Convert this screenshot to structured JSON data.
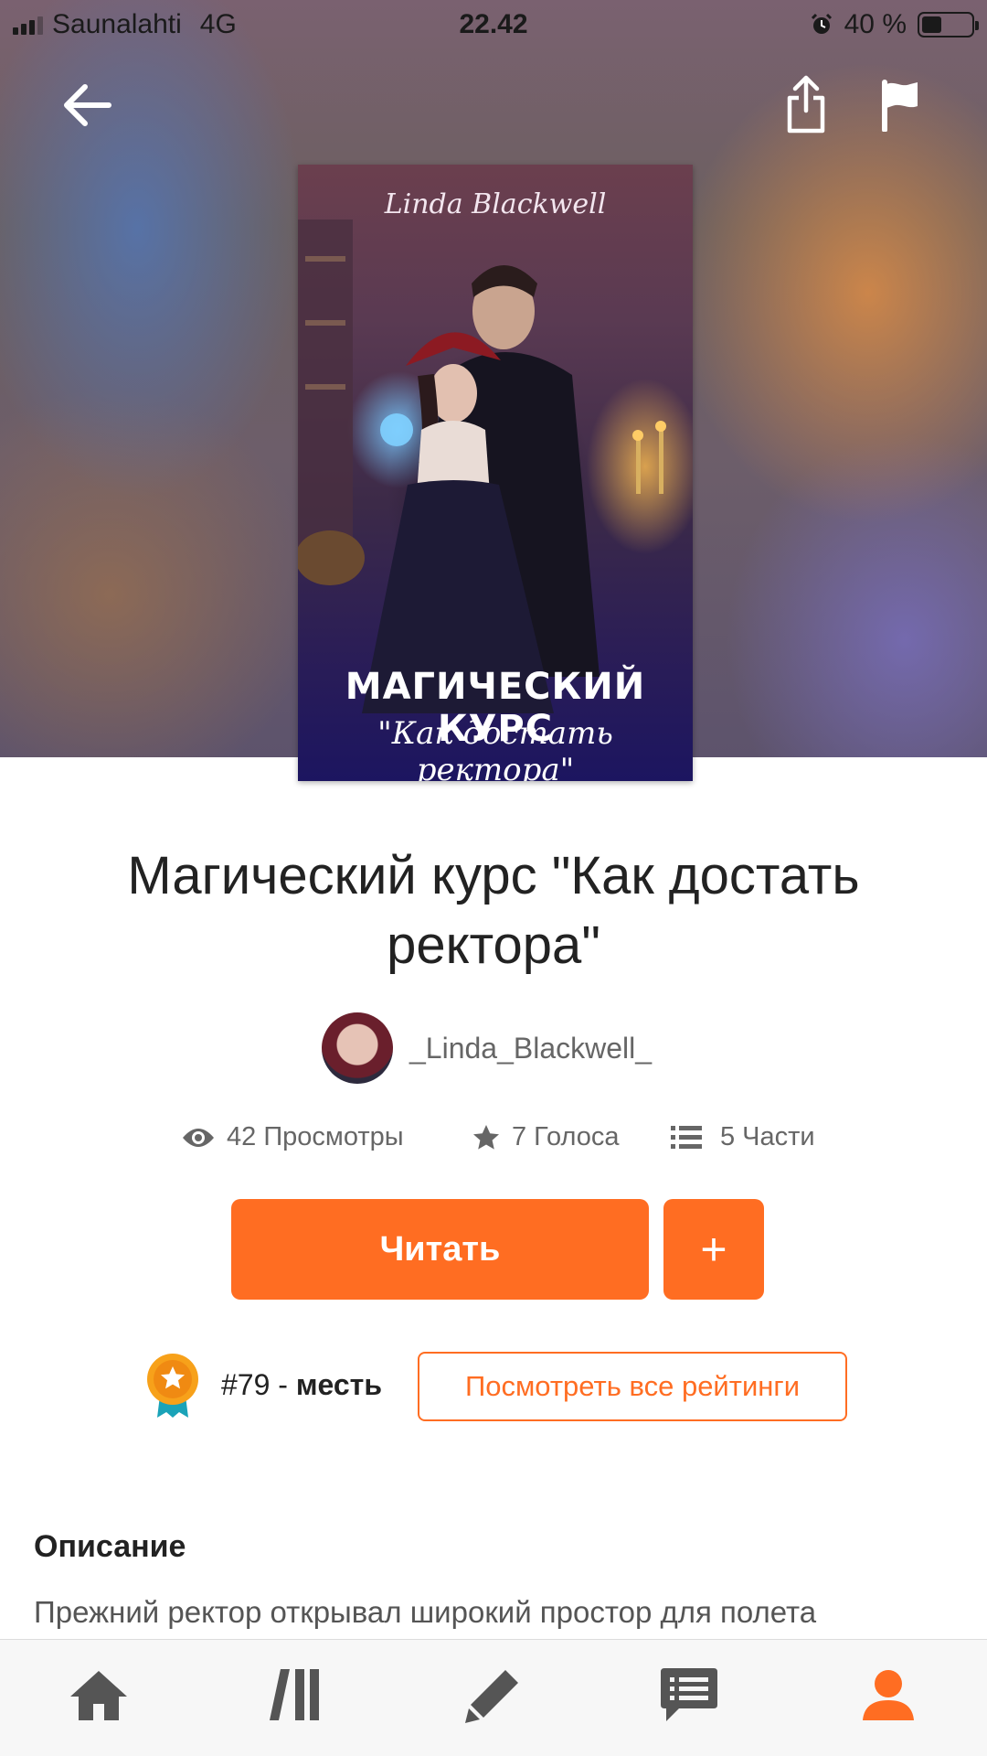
{
  "status_bar": {
    "carrier": "Saunalahti",
    "network": "4G",
    "time": "22.42",
    "battery": "40 %",
    "battery_level": 0.4
  },
  "top_nav": {
    "back_icon": "arrow-left-icon",
    "share_icon": "share-icon",
    "report_icon": "flag-icon"
  },
  "cover": {
    "author": "Linda Blackwell",
    "title": "МАГИЧЕСКИЙ КУРС",
    "subtitle": "\"Как достать ректора\""
  },
  "book": {
    "title": "Магический курс \"Как достать ректора\"",
    "author": "_Linda_Blackwell_"
  },
  "stats": {
    "views": "42 Просмотры",
    "votes": "7 Голоса",
    "parts": "5 Части"
  },
  "actions": {
    "read_label": "Читать",
    "add_label": "+"
  },
  "ranking": {
    "rank": "#79",
    "separator": " - ",
    "tag": "месть",
    "view_all_label": "Посмотреть все рейтинги"
  },
  "description": {
    "heading": "Описание",
    "text": "Прежний ректор открывал широкий простор для полета"
  },
  "bottom_nav": {
    "items": [
      "home-icon",
      "library-icon",
      "write-icon",
      "messages-icon",
      "profile-icon"
    ],
    "active_color": "#ff6d22",
    "inactive_color": "#555555"
  },
  "colors": {
    "accent": "#ff6d22"
  }
}
